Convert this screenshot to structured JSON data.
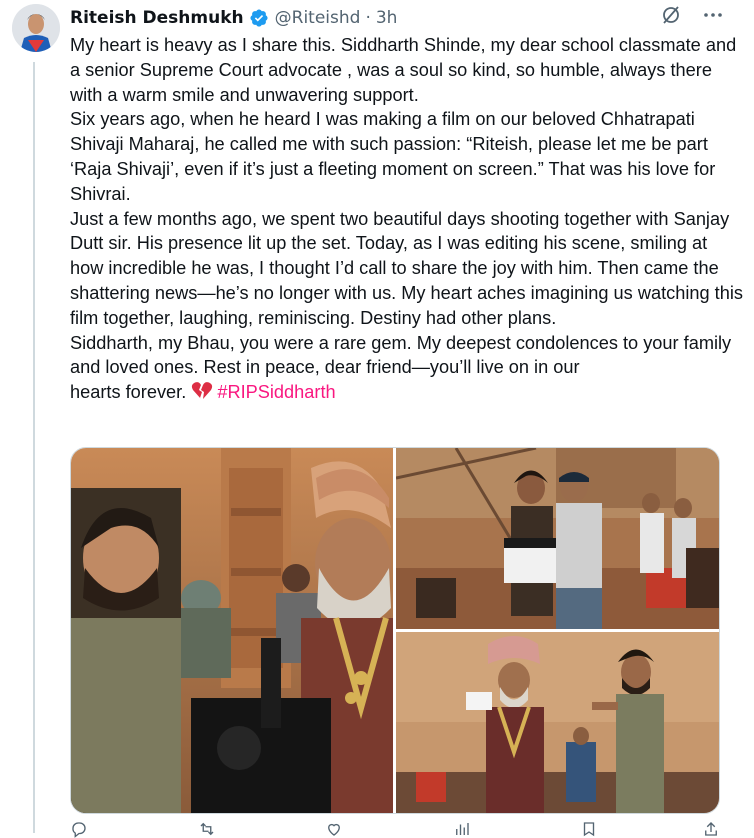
{
  "author": {
    "display_name": "Riteish Deshmukh",
    "handle": "@Riteishd",
    "separator": "·",
    "time": "3h",
    "verified": true
  },
  "header_icons": [
    "grok-slash-icon",
    "more-options-icon"
  ],
  "tweet": {
    "paragraphs": [
      "My heart is heavy as I share this. Siddharth Shinde, my dear school classmate and a senior Supreme Court advocate , was a soul so kind, so humble, always there with a warm smile and unwavering support.",
      "Six years ago, when he heard I was making a film on our beloved Chhatrapati Shivaji Maharaj, he called me with such passion: “Riteish, please let me be part ‘Raja Shivaji’, even if it’s just a fleeting moment on screen.” That was his love for Shivrai.",
      "Just a few months ago, we spent two beautiful days shooting together with Sanjay Dutt sir. His presence lit up the set. Today, as I was editing his scene, smiling at how incredible he was, I thought I’d call to share the joy with him. Then came the shattering news—he’s no longer with us. My heart aches imagining us watching this film together, laughing, reminiscing. Destiny had other plans.",
      "Siddharth, my Bhau, you were a rare gem. My deepest condolences to your family and loved ones. Rest in peace, dear friend—you’ll live on in our"
    ],
    "last_line": "hearts forever.",
    "emoji": "broken-heart-icon",
    "hashtag": "#RIPSiddharth"
  },
  "media": {
    "photos": [
      {
        "name": "photo-costume-scene",
        "description_icon": "photo"
      },
      {
        "name": "photo-set-clapperboard",
        "description_icon": "photo"
      },
      {
        "name": "photo-directing-scene",
        "description_icon": "photo"
      }
    ]
  },
  "actions": [
    {
      "name": "reply",
      "count": ""
    },
    {
      "name": "repost",
      "count": ""
    },
    {
      "name": "like",
      "count": ""
    },
    {
      "name": "views",
      "count": ""
    },
    {
      "name": "bookmark",
      "count": ""
    },
    {
      "name": "share",
      "count": ""
    }
  ],
  "colors": {
    "text": "#0f1419",
    "muted": "#536471",
    "hashtag": "#f91880",
    "verified": "#1d9bf0",
    "line": "#cfd9de"
  }
}
